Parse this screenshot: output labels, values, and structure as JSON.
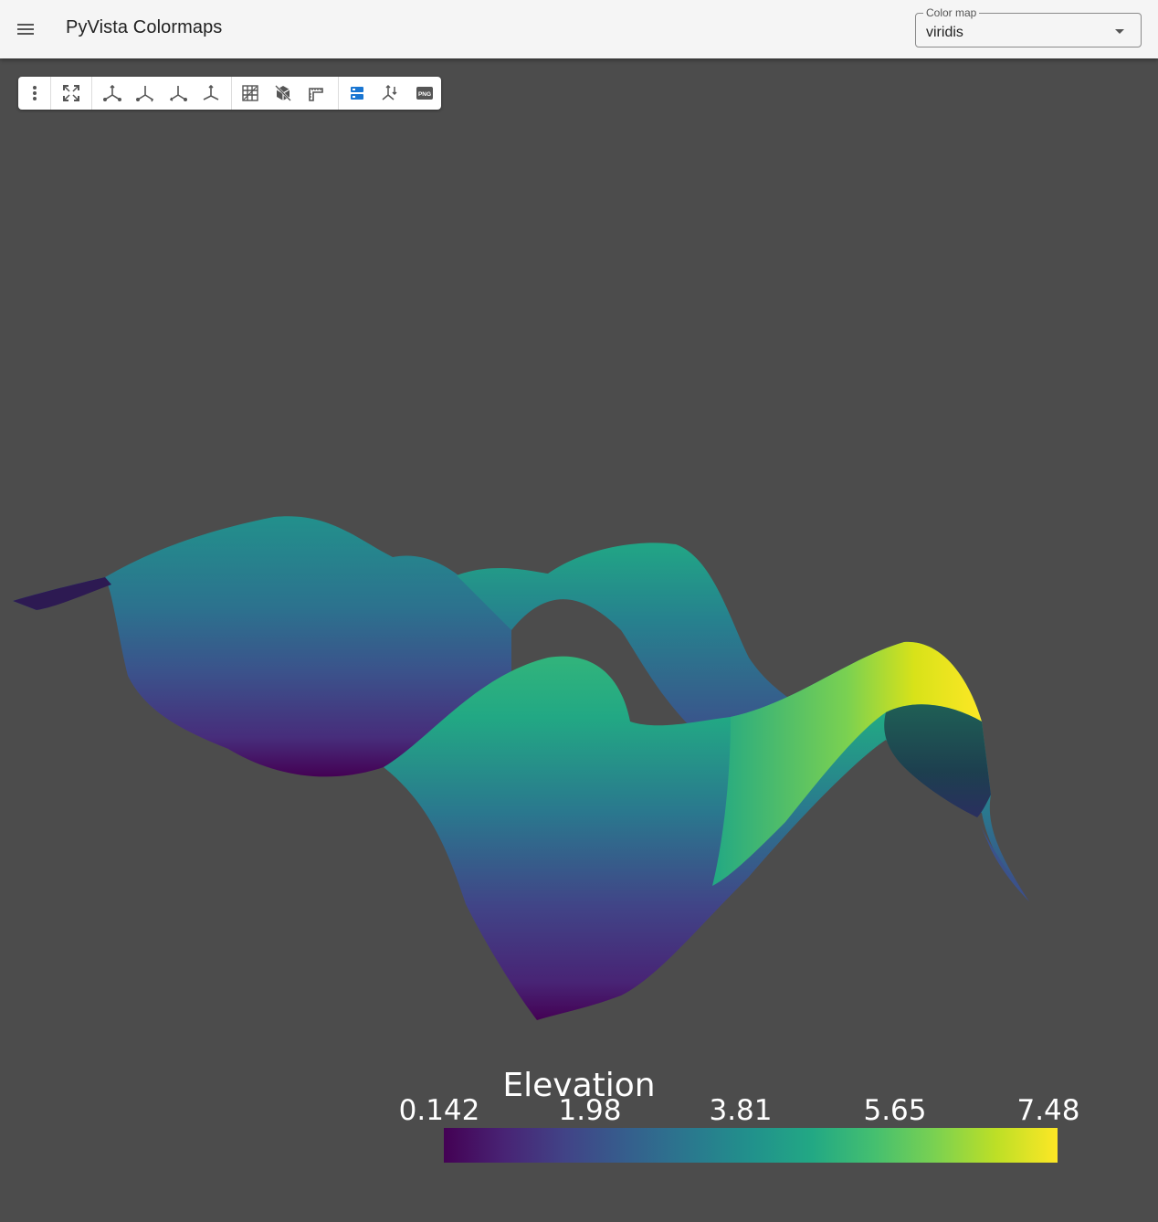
{
  "appbar": {
    "title": "PyVista Colormaps",
    "menu_icon": "hamburger-menu-icon"
  },
  "colormap_select": {
    "label": "Color map",
    "value": "viridis",
    "caret_icon": "dropdown-caret-icon"
  },
  "toolbar": {
    "buttons": [
      {
        "name": "more-options",
        "icon": "vertical-dots-icon"
      },
      {
        "name": "reset-camera",
        "icon": "fit-screen-icon"
      },
      {
        "name": "view-x",
        "icon": "axis-view-icon"
      },
      {
        "name": "view-y",
        "icon": "axis-view-icon"
      },
      {
        "name": "view-z",
        "icon": "axis-view-icon"
      },
      {
        "name": "view-isometric",
        "icon": "axis-view-icon"
      },
      {
        "name": "toggle-grid",
        "icon": "grid-icon"
      },
      {
        "name": "toggle-bounds",
        "icon": "cube-icon"
      },
      {
        "name": "toggle-ruler",
        "icon": "ruler-icon"
      },
      {
        "name": "toggle-scalar-bar",
        "icon": "layers-icon",
        "active": true
      },
      {
        "name": "toggle-axes",
        "icon": "axes-icon"
      },
      {
        "name": "screenshot",
        "icon": "png-icon",
        "text": "PNG"
      }
    ]
  },
  "scalar_bar": {
    "title": "Elevation",
    "ticks": [
      "0.142",
      "1.98",
      "3.81",
      "5.65",
      "7.48"
    ],
    "range": [
      0.142,
      7.48
    ],
    "colormap": "viridis"
  },
  "colors": {
    "background": "#4c4c4c",
    "appbar": "#f5f5f5",
    "active_icon": "#1976d2"
  }
}
